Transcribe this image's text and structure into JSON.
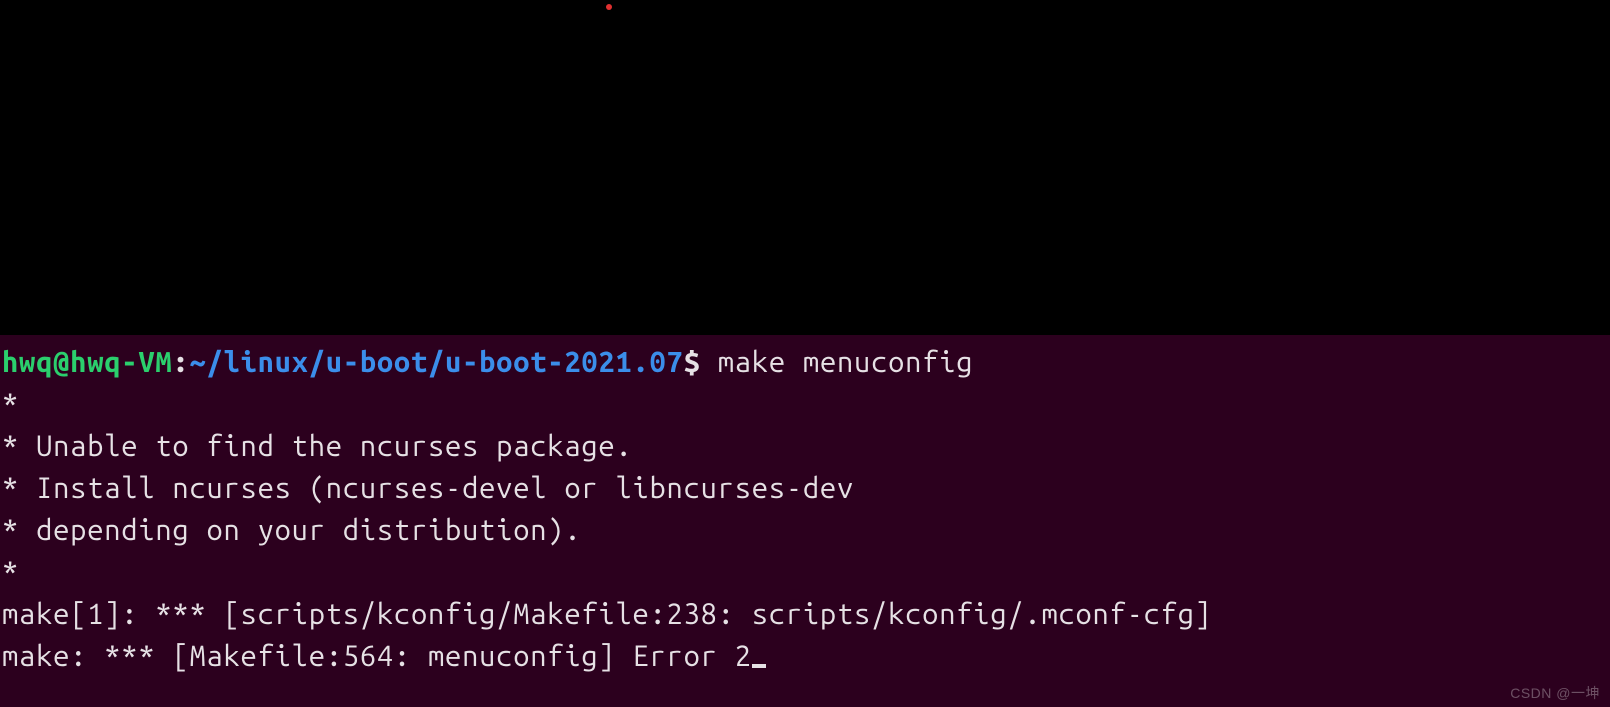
{
  "top_marker": {
    "present": true,
    "color": "#e03030"
  },
  "prompt": {
    "user_host": "hwq@hwq-VM",
    "separator": ":",
    "path": "~/linux/u-boot/u-boot-2021.07",
    "symbol": "$",
    "command": "make menuconfig"
  },
  "output_lines": [
    "*",
    "* Unable to find the ncurses package.",
    "* Install ncurses (ncurses-devel or libncurses-dev",
    "* depending on your distribution).",
    "*",
    "make[1]: *** [scripts/kconfig/Makefile:238: scripts/kconfig/.mconf-cfg]",
    "make: *** [Makefile:564: menuconfig] Error 2"
  ],
  "watermark": "CSDN @一坤"
}
